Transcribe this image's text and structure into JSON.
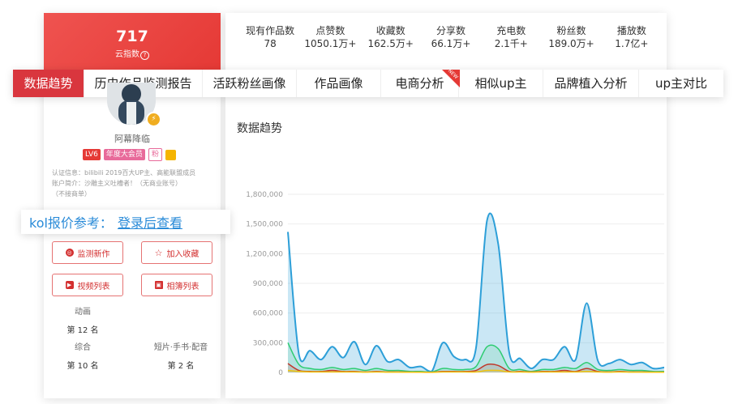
{
  "profile": {
    "index_value": "717",
    "index_label": "云指数",
    "username": "阿幕降临",
    "level": "LV6",
    "vip": "年度大会员",
    "fan_tag": "粉",
    "cert_line1": "认证信息：bilibili 2019百大UP主、高能联盟成员",
    "cert_line2": "账户简介：沙雕主义吐槽者！（无商业账号）",
    "cert_line3": "（不接商单）"
  },
  "stats": [
    {
      "label": "现有作品数",
      "value": "78"
    },
    {
      "label": "点赞数",
      "value": "1050.1万+"
    },
    {
      "label": "收藏数",
      "value": "162.5万+"
    },
    {
      "label": "分享数",
      "value": "66.1万+"
    },
    {
      "label": "充电数",
      "value": "2.1千+"
    },
    {
      "label": "粉丝数",
      "value": "189.0万+"
    },
    {
      "label": "播放数",
      "value": "1.7亿+"
    }
  ],
  "tabs": [
    {
      "label": "数据趋势"
    },
    {
      "label": "历史作品监测报告"
    },
    {
      "label": "活跃粉丝画像"
    },
    {
      "label": "作品画像"
    },
    {
      "label": "电商分析",
      "badge": "NEW"
    },
    {
      "label": "相似up主"
    },
    {
      "label": "品牌植入分析"
    },
    {
      "label": "up主对比"
    }
  ],
  "kol": {
    "label": "kol报价参考：",
    "link": "登录后查看"
  },
  "buttons": {
    "monitor": "监测新作",
    "favorite": "加入收藏",
    "videos": "视频列表",
    "albums": "相簿列表"
  },
  "rankings": [
    {
      "category": "动画",
      "rank": "第 12 名"
    },
    {
      "category": "综合",
      "rank": "第 10 名"
    },
    {
      "category": "短片·手书·配音",
      "rank": "第 2 名"
    }
  ],
  "chart_title": "数据趋势",
  "chart_data": {
    "type": "area",
    "yticks": [
      "1,800,000",
      "1,500,000",
      "1,200,000",
      "900,000",
      "600,000",
      "300,000",
      "0"
    ],
    "ylim": [
      0,
      1800000
    ],
    "series": [
      {
        "color": "#2d9fd8",
        "values": [
          1420000,
          180000,
          220000,
          130000,
          260000,
          150000,
          310000,
          80000,
          270000,
          110000,
          130000,
          50000,
          60000,
          10000,
          300000,
          160000,
          130000,
          250000,
          1540000,
          1300000,
          200000,
          140000,
          40000,
          130000,
          130000,
          260000,
          130000,
          700000,
          120000,
          90000,
          130000,
          80000,
          100000,
          40000,
          50000
        ]
      },
      {
        "color": "#2ecc71",
        "values": [
          300000,
          80000,
          40000,
          30000,
          50000,
          30000,
          40000,
          20000,
          40000,
          20000,
          20000,
          10000,
          10000,
          5000,
          40000,
          30000,
          30000,
          60000,
          260000,
          240000,
          40000,
          30000,
          10000,
          30000,
          30000,
          50000,
          40000,
          100000,
          30000,
          20000,
          30000,
          20000,
          20000,
          10000,
          10000
        ]
      },
      {
        "color": "#c0392b",
        "values": [
          90000,
          20000,
          10000,
          10000,
          20000,
          10000,
          10000,
          5000,
          10000,
          5000,
          5000,
          3000,
          3000,
          2000,
          10000,
          10000,
          10000,
          20000,
          80000,
          70000,
          10000,
          10000,
          5000,
          10000,
          10000,
          20000,
          10000,
          40000,
          10000,
          5000,
          10000,
          5000,
          5000,
          3000,
          3000
        ]
      },
      {
        "color": "#f1c40f",
        "values": [
          20000,
          10000,
          5000,
          5000,
          5000,
          5000,
          5000,
          3000,
          5000,
          3000,
          3000,
          2000,
          2000,
          1000,
          5000,
          5000,
          5000,
          5000,
          20000,
          20000,
          5000,
          5000,
          3000,
          5000,
          5000,
          5000,
          5000,
          10000,
          5000,
          3000,
          5000,
          3000,
          3000,
          2000,
          2000
        ]
      }
    ],
    "grid": true
  }
}
